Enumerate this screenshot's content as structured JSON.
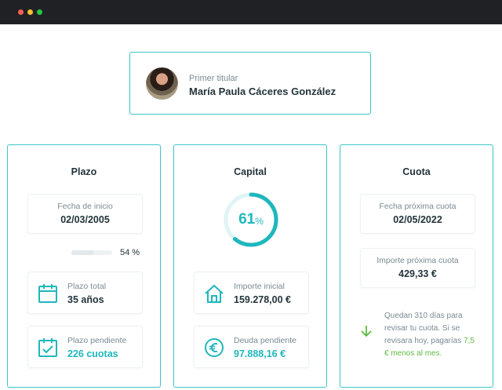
{
  "owner": {
    "label": "Primer titular",
    "name": "María Paula Cáceres González",
    "avatar_icon": "user-avatar-photo"
  },
  "plazo": {
    "title": "Plazo",
    "fecha_inicio": {
      "label": "Fecha de inicio",
      "value": "02/03/2005"
    },
    "progress": {
      "value": 0.54,
      "text": "54 %"
    },
    "total": {
      "label": "Plazo total",
      "value": "35 años",
      "icon": "calendar-icon"
    },
    "pendiente": {
      "label": "Plazo pendiente",
      "value": "226 cuotas",
      "icon": "calendar-check-icon"
    }
  },
  "capital": {
    "title": "Capital",
    "ring": {
      "value": "61",
      "unit": "%",
      "fraction": 0.61
    },
    "importe_inicial": {
      "label": "Importe inicial",
      "value": "159.278,00 €",
      "icon": "house-icon"
    },
    "deuda_pendiente": {
      "label": "Deuda pendiente",
      "value": "97.888,16 €",
      "icon": "euro-icon"
    }
  },
  "cuota": {
    "title": "Cuota",
    "fecha_proxima": {
      "label": "Fecha próxima cuota",
      "value": "02/05/2022"
    },
    "importe_proximo": {
      "label": "Importe próxima cuota",
      "value": "429,33 €"
    },
    "notice": {
      "line1": "Quedan 310 días para revisar tu cuota. Si se revisara hoy, pagarías",
      "highlight": "7,5 € menos al mes.",
      "icon": "arrow-down-icon"
    }
  },
  "colors": {
    "accent": "#3cc4c8",
    "teal_text": "#1fb7bc",
    "positive": "#5dbb43"
  }
}
